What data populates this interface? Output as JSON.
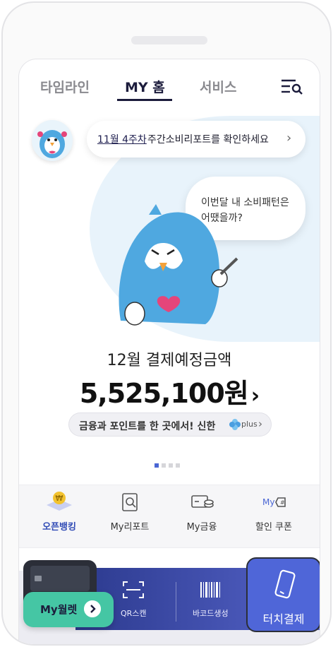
{
  "tabs": [
    {
      "label": "타임라인"
    },
    {
      "label": "MY 홈"
    },
    {
      "label": "서비스"
    }
  ],
  "notice": {
    "link_text": "11월 4주차",
    "rest_text": "주간소비리포트를 확인하세요"
  },
  "bubble": {
    "line1": "이번달 내 소비패턴은",
    "line2": "어땠을까?"
  },
  "summary": {
    "title": "12월 결제예정금액",
    "amount": "5,525,100원"
  },
  "promo": {
    "text": "금융과 포인트를 한 곳에서! 신한",
    "plus": "plus"
  },
  "pager": {
    "total": 4,
    "active": 1
  },
  "quick_menu": [
    {
      "label": "오픈뱅킹",
      "icon": "open-banking-icon",
      "active": true
    },
    {
      "label": "My리포트",
      "icon": "report-icon",
      "active": false
    },
    {
      "label": "My금융",
      "icon": "finance-icon",
      "active": false
    },
    {
      "label": "할인 쿠폰",
      "icon": "coupon-icon",
      "active": false
    }
  ],
  "bottom": {
    "wallet_label": "My월렛",
    "qr_label": "QR스캔",
    "barcode_label": "바코드생성",
    "touchpay_label": "터치결제"
  },
  "colors": {
    "accent": "#4a66d4",
    "brand_navy": "#1c1c3c",
    "wallet_green": "#45c6a4",
    "touchpay_blue": "#4f66d8"
  }
}
